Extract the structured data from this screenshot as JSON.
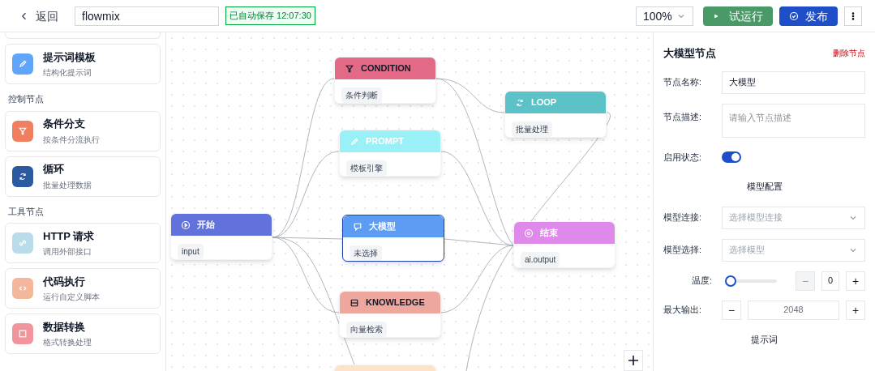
{
  "toolbar": {
    "back": "返回",
    "flow_name": "flowmix",
    "autosave": "已自动保存 12:07:30",
    "zoom": "100%",
    "run": "试运行",
    "publish": "发布"
  },
  "sidebar": [
    {
      "kind": "card",
      "title": "提示词模板",
      "subtitle": "结构化提示词",
      "color": "#60a5fa"
    },
    {
      "kind": "heading",
      "title": "控制节点"
    },
    {
      "kind": "card",
      "title": "条件分支",
      "subtitle": "按条件分流执行",
      "color": "#f07f5f"
    },
    {
      "kind": "card",
      "title": "循环",
      "subtitle": "批量处理数据",
      "color": "#2c5aa0"
    },
    {
      "kind": "heading",
      "title": "工具节点"
    },
    {
      "kind": "card",
      "title": "HTTP 请求",
      "subtitle": "调用外部接口",
      "color": "#b9dcea"
    },
    {
      "kind": "card",
      "title": "代码执行",
      "subtitle": "运行自定义脚本",
      "color": "#f4b79c"
    },
    {
      "kind": "card",
      "title": "数据转换",
      "subtitle": "格式转换处理",
      "color": "#f0969a"
    }
  ],
  "nodes": [
    {
      "kind": "condition",
      "title": "CONDITION",
      "tag": "条件判断",
      "color": "#e26a87",
      "selected": false
    },
    {
      "kind": "prompt",
      "title": "PROMPT",
      "tag": "模板引擎",
      "color": "#99f0f7",
      "selected": false
    },
    {
      "kind": "start",
      "title": "开始",
      "tag": "input",
      "color": "#6172dc",
      "selected": false
    },
    {
      "kind": "llm",
      "title": "大模型",
      "tag": "未选择",
      "color": "#5c9cf3",
      "selected": true
    },
    {
      "kind": "knowledge",
      "title": "KNOWLEDGE",
      "tag": "向量检索",
      "color": "#eea79d",
      "selected": false
    },
    {
      "kind": "loop",
      "title": "LOOP",
      "tag": "批量处理",
      "color": "#5bc3c7",
      "selected": false
    },
    {
      "kind": "end",
      "title": "结束",
      "tag": "ai.output",
      "color": "#df8aeb",
      "selected": false
    },
    {
      "kind": "partial",
      "color": "#fde3c8",
      "selected": false
    }
  ],
  "panel": {
    "title": "大模型节点",
    "delete": "删除节点",
    "fields": [
      {
        "kind": "input",
        "label": "节点名称:",
        "value": "大模型"
      },
      {
        "kind": "textarea",
        "label": "节点描述:",
        "placeholder": "请输入节点描述"
      },
      {
        "kind": "toggle",
        "label": "启用状态:",
        "on": true
      },
      {
        "kind": "section",
        "label": "模型配置"
      },
      {
        "kind": "select",
        "label": "模型连接:",
        "placeholder": "选择模型连接"
      },
      {
        "kind": "select",
        "label": "模型选择:",
        "placeholder": "选择模型"
      },
      {
        "kind": "slider",
        "label": "温度:",
        "level": 0,
        "value": "0",
        "decrement": "−",
        "increment": "+"
      },
      {
        "kind": "number",
        "label": "最大输出:",
        "value": "2048",
        "decrement": "−",
        "increment": "+"
      },
      {
        "kind": "section",
        "label": "提示词"
      }
    ]
  }
}
